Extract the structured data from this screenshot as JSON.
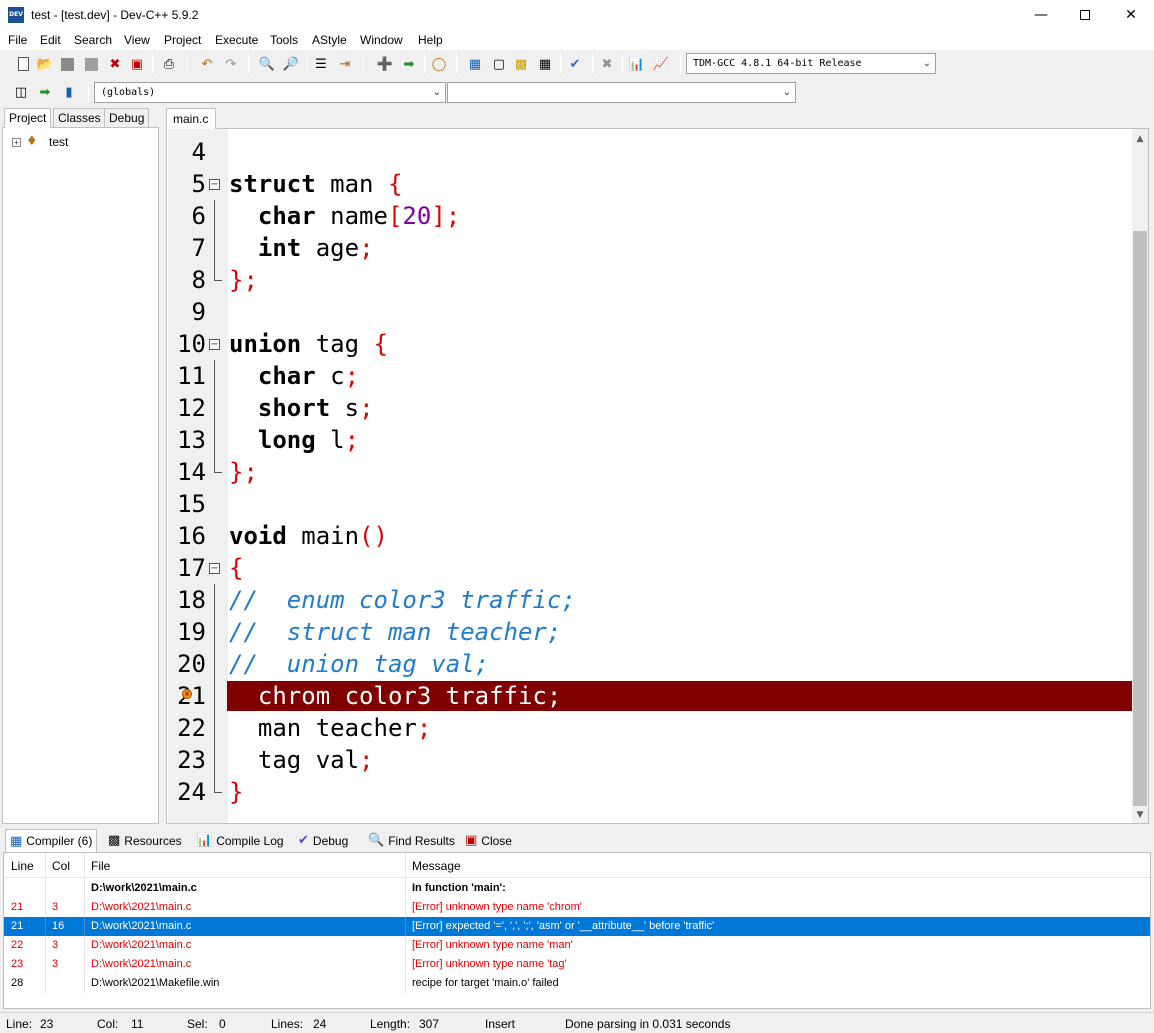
{
  "window": {
    "title": "test - [test.dev] - Dev-C++ 5.9.2",
    "icon_text": "DEV",
    "minimize_icon": "minimize-icon",
    "maximize_icon": "maximize-icon",
    "close_icon": "close-icon"
  },
  "menu": [
    "File",
    "Edit",
    "Search",
    "View",
    "Project",
    "Execute",
    "Tools",
    "AStyle",
    "Window",
    "Help"
  ],
  "toolbar": {
    "compiler_select": "TDM-GCC 4.8.1 64-bit Release",
    "scope_select": "(globals)",
    "member_select": ""
  },
  "left_panel": {
    "tabs": [
      "Project",
      "Classes",
      "Debug"
    ],
    "tree": {
      "expander": "+",
      "label": "test"
    }
  },
  "editor": {
    "tab": "main.c",
    "lines": [
      {
        "n": "4"
      },
      {
        "n": "5"
      },
      {
        "n": "6"
      },
      {
        "n": "7"
      },
      {
        "n": "8"
      },
      {
        "n": "9"
      },
      {
        "n": "10"
      },
      {
        "n": "11"
      },
      {
        "n": "12"
      },
      {
        "n": "13"
      },
      {
        "n": "14"
      },
      {
        "n": "15"
      },
      {
        "n": "16"
      },
      {
        "n": "17"
      },
      {
        "n": "18"
      },
      {
        "n": "19"
      },
      {
        "n": "20"
      },
      {
        "n": "21"
      },
      {
        "n": "22"
      },
      {
        "n": "23"
      },
      {
        "n": "24"
      }
    ],
    "tokens": {
      "l5": [
        "struct",
        " man ",
        "{"
      ],
      "l6": [
        "  ",
        "char",
        " name",
        "[",
        "20",
        "];"
      ],
      "l7": [
        "  ",
        "int",
        " age",
        ";"
      ],
      "l8": [
        "};"
      ],
      "l10": [
        "union",
        " tag ",
        "{"
      ],
      "l11": [
        "  ",
        "char",
        " c",
        ";"
      ],
      "l12": [
        "  ",
        "short",
        " s",
        ";"
      ],
      "l13": [
        "  ",
        "long",
        " l",
        ";"
      ],
      "l14": [
        "};"
      ],
      "l16": [
        "void",
        " main",
        "()"
      ],
      "l17": [
        "{"
      ],
      "l18": "//  enum color3 traffic;",
      "l19": "//  struct man teacher;",
      "l20": "//  union tag val;",
      "l21": "  chrom color3 traffic;",
      "l22": [
        "  man teacher",
        ";"
      ],
      "l23": [
        "  tag val",
        ";"
      ],
      "l24": [
        "}"
      ]
    }
  },
  "bottom_tabs": [
    "Compiler (6)",
    "Resources",
    "Compile Log",
    "Debug",
    "Find Results",
    "Close"
  ],
  "results": {
    "columns": [
      "Line",
      "Col",
      "File",
      "Message"
    ],
    "rows": [
      {
        "line": "",
        "col": "",
        "file": "D:\\work\\2021\\main.c",
        "msg": "In function 'main':",
        "style": "bold"
      },
      {
        "line": "21",
        "col": "3",
        "file": "D:\\work\\2021\\main.c",
        "msg": "[Error] unknown type name 'chrom'",
        "style": "red"
      },
      {
        "line": "21",
        "col": "16",
        "file": "D:\\work\\2021\\main.c",
        "msg": "[Error] expected '=', ',', ';', 'asm' or '__attribute__' before 'traffic'",
        "style": "sel"
      },
      {
        "line": "22",
        "col": "3",
        "file": "D:\\work\\2021\\main.c",
        "msg": "[Error] unknown type name 'man'",
        "style": "red"
      },
      {
        "line": "23",
        "col": "3",
        "file": "D:\\work\\2021\\main.c",
        "msg": "[Error] unknown type name 'tag'",
        "style": "red"
      },
      {
        "line": "28",
        "col": "",
        "file": "D:\\work\\2021\\Makefile.win",
        "msg": "recipe for target 'main.o' failed",
        "style": "normal"
      }
    ]
  },
  "status": {
    "line_label": "Line:",
    "line": "23",
    "col_label": "Col:",
    "col": "11",
    "sel_label": "Sel:",
    "sel": "0",
    "lines_label": "Lines:",
    "lines": "24",
    "length_label": "Length:",
    "length": "307",
    "mode": "Insert",
    "message": "Done parsing in 0.031 seconds"
  },
  "colors": {
    "error_line_bg": "#800000",
    "selection": "#0078d7",
    "error_text": "#e00000",
    "comment": "#1f7ccc",
    "number": "#8000a0",
    "symbol": "#e00000"
  }
}
